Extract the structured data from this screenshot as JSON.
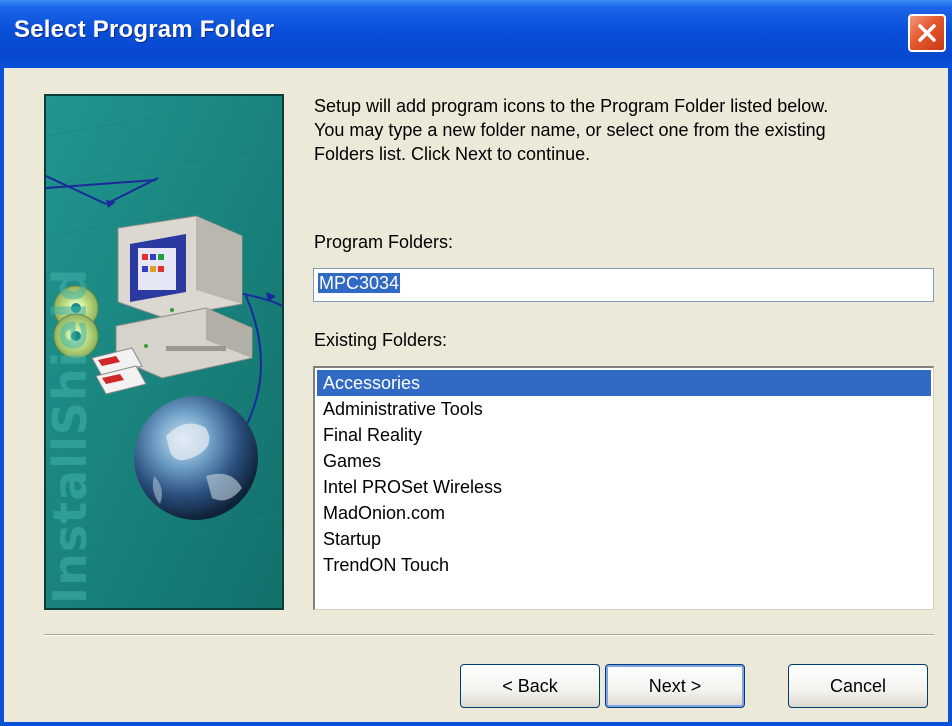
{
  "window": {
    "title": "Select Program Folder"
  },
  "instruction": "Setup will add program icons to the Program Folder listed below.\nYou may type a new folder name, or select one from the existing\nFolders list.  Click Next to continue.",
  "program_folders": {
    "label": "Program Folders:",
    "value": "MPC3034"
  },
  "existing_folders": {
    "label": "Existing Folders:",
    "items": [
      "Accessories",
      "Administrative Tools",
      "Final Reality",
      "Games",
      "Intel PROSet Wireless",
      "MadOnion.com",
      "Startup",
      "TrendON Touch"
    ],
    "selected": "Accessories"
  },
  "art": {
    "brand": "InstallShield"
  },
  "buttons": {
    "back": "< Back",
    "next": "Next >",
    "cancel": "Cancel"
  },
  "colors": {
    "titlebar": "#0a50d8",
    "selection": "#316ac5",
    "art_teal": "#1a8a84",
    "close": "#e4572e"
  }
}
